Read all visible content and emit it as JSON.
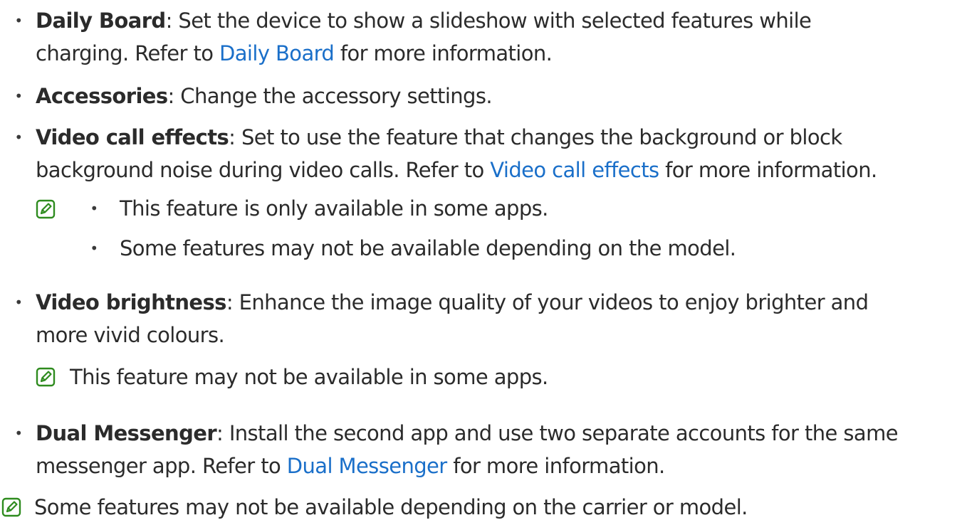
{
  "items": [
    {
      "term": "Daily Board",
      "line1": ": Set the device to show a slideshow with selected features while",
      "line2_before": "charging. Refer to ",
      "link": "Daily Board",
      "line2_after": " for more information."
    },
    {
      "term": "Accessories",
      "line1": ": Change the accessory settings."
    },
    {
      "term": "Video call effects",
      "line1": ": Set to use the feature that changes the background or block",
      "line2_before": "background noise during video calls. Refer to ",
      "link": "Video call effects",
      "line2_after": " for more information."
    },
    {
      "term": "Video brightness",
      "line1": ": Enhance the image quality of your videos to enjoy brighter and",
      "line2": "more vivid colours."
    },
    {
      "term": "Dual Messenger",
      "line1": ": Install the second app and use two separate accounts for the same",
      "line2_before": "messenger app. Refer to ",
      "link": "Dual Messenger",
      "line2_after": " for more information."
    }
  ],
  "notes": {
    "video_call_effects": [
      "This feature is only available in some apps.",
      "Some features may not be available depending on the model."
    ],
    "video_brightness": "This feature may not be available in some apps.",
    "footer": "Some features may not be available depending on the carrier or model."
  },
  "bullet_symbol": "•",
  "icons": {
    "note": "note-pencil-icon"
  },
  "colors": {
    "text": "#2b2b2b",
    "link": "#1a6fc9",
    "note_icon": "#2e8b1e"
  }
}
